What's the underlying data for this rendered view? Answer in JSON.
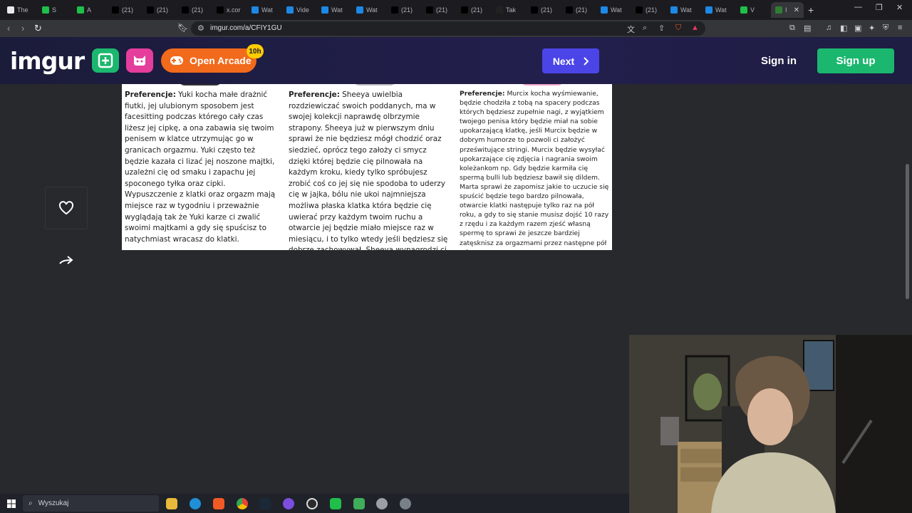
{
  "browser": {
    "tabs": [
      {
        "title": "The"
      },
      {
        "title": "S"
      },
      {
        "title": "A"
      },
      {
        "title": "(21)"
      },
      {
        "title": "(21)"
      },
      {
        "title": "(21)"
      },
      {
        "title": "x.cor"
      },
      {
        "title": "Wat"
      },
      {
        "title": "Vide"
      },
      {
        "title": "Wat"
      },
      {
        "title": "Wat"
      },
      {
        "title": "(21)"
      },
      {
        "title": "(21)"
      },
      {
        "title": "(21)"
      },
      {
        "title": "Tak"
      },
      {
        "title": "(21)"
      },
      {
        "title": "(21)"
      },
      {
        "title": "Wat"
      },
      {
        "title": "(21)"
      },
      {
        "title": "Wat"
      },
      {
        "title": "Wat"
      },
      {
        "title": "V"
      },
      {
        "title": "I"
      }
    ],
    "url": "imgur.com/a/CFIY1GU"
  },
  "header": {
    "logo": "imgur",
    "arcade_label": "Open Arcade",
    "arcade_badge": "10h",
    "next_label": "Next",
    "signin_label": "Sign in",
    "signup_label": "Sign up"
  },
  "post": {
    "columns": [
      {
        "label": "Preferencje:",
        "text": " Yuki kocha małe drażnić fiutki, jej ulubionym sposobem jest facesitting podczas którego cały czas liżesz jej cipkę, a ona zabawia się twoim penisem w klatce utrzymując go w granicach orgazmu. Yuki często też będzie kazała ci lizać jej noszone majtki, uzależni cię od smaku i zapachu jej spoconego tyłka oraz cipki. Wypuszczenie z klatki oraz orgazm mają miejsce raz w tygodniu i przeważnie wyglądają tak że Yuki karze ci zwalić swoimi majtkami a gdy się spuścisz to natychmiast wracasz do klatki."
      },
      {
        "label": "Preferencje:",
        "text": " Sheeya uwielbia rozdziewiczać swoich poddanych, ma w swojej kolekcji naprawdę olbrzymie strapony. Sheeya już w pierwszym dniu sprawi że nie będziesz mógł chodzić oraz siedzieć, oprócz tego założy ci smycz dzięki której będzie cię pilnowała na każdym kroku, kiedy tylko spróbujesz zrobić coś co jej się nie spodoba to uderzy cię w jajka, bólu nie ukoi najmniejsza możliwa płaska klatka która będzie cię uwierać przy każdym twoim ruchu a otwarcie jej będzie miało miejsce raz w miesiącu, i to tylko wtedy jeśli będziesz się dobrze zachowywał, Sheeya wynagrodzi ci miesiąc posłuszeństwa zrujnowanym handjobem."
      },
      {
        "label": "Preferencje:",
        "text": " Murcix kocha wyśmiewanie, będzie chodziła z tobą na spacery podczas których będziesz zupełnie nagi, z wyjątkiem twojego penisa który będzie miał na sobie upokarzającą klatkę, jeśli Murcix będzie w dobrym humorze to pozwoli ci założyć prześwitujące stringi. Murcix będzie wysyłać upokarzające cię zdjęcia i nagrania swoim koleżankom np. Gdy będzie karmiła cię spermą bulli lub będziesz bawił się dildem. Marta sprawi że zapomisz jakie to uczucie się spuścić będzie tego bardzo pilnowała, otwarcie klatki następuje tylko raz na pół roku, a gdy to się stanie musisz dojść 10 razy z rzędu i za każdym razem zjeść własną spermę to sprawi że jeszcze bardziej zatęsknisz za orgazmami przez następne pół roku."
      }
    ]
  },
  "taskbar": {
    "search_placeholder": "Wyszukaj"
  },
  "colors": {
    "header_bg": "#1e1d42",
    "arcade": "#f26a1c",
    "next": "#4b45e8",
    "signup": "#1bb76e",
    "new_post": "#1bb76e",
    "pink": "#e53d9c"
  }
}
